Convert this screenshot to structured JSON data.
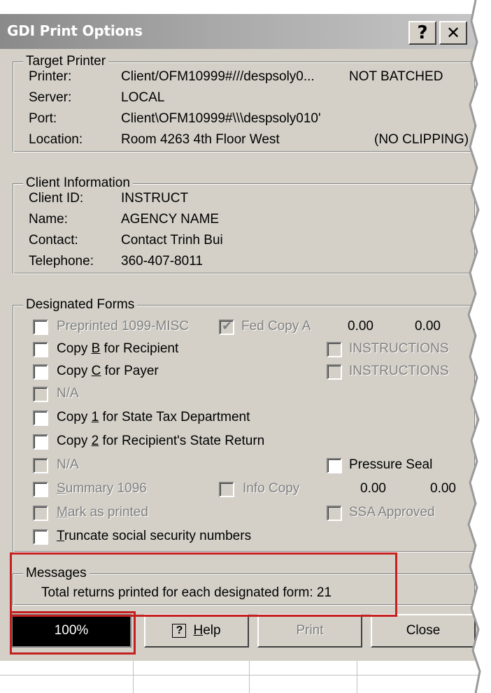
{
  "title": "GDI Print Options",
  "title_buttons": {
    "help": "?",
    "close": "✕"
  },
  "target_printer": {
    "legend": "Target Printer",
    "printer_label": "Printer:",
    "printer_value": "Client/OFM10999#///despsoly0...",
    "batch_status": "NOT BATCHED",
    "server_label": "Server:",
    "server_value": "LOCAL",
    "port_label": "Port:",
    "port_value": "Client\\OFM10999#\\\\\\despsoly010'",
    "location_label": "Location:",
    "location_value": "Room 4263 4th Floor West",
    "clipping_status": "(NO CLIPPING)"
  },
  "client_info": {
    "legend": "Client Information",
    "client_id_label": "Client ID:",
    "client_id_value": "INSTRUCT",
    "name_label": "Name:",
    "name_value": "AGENCY NAME",
    "contact_label": "Contact:",
    "contact_value": "Contact Trinh Bui",
    "telephone_label": "Telephone:",
    "telephone_value": "360-407-8011"
  },
  "forms": {
    "legend": "Designated Forms",
    "preprinted": "Preprinted 1099-MISC",
    "fed_copy_a": "Fed Copy A",
    "fed_val1": "0.00",
    "fed_val2": "0.00",
    "copy_b_pre": "Copy ",
    "copy_b_key": "B",
    "copy_b_post": " for Recipient",
    "instructions1": "INSTRUCTIONS",
    "copy_c_pre": "Copy ",
    "copy_c_key": "C",
    "copy_c_post": " for Payer",
    "instructions2": "INSTRUCTIONS",
    "na1": "N/A",
    "copy_1_pre": "Copy ",
    "copy_1_key": "1",
    "copy_1_post": " for State Tax Department",
    "copy_2_pre": "Copy ",
    "copy_2_key": "2",
    "copy_2_post": " for Recipient's State Return",
    "na2": "N/A",
    "pressure_seal": "Pressure Seal",
    "summary_key": "S",
    "summary_post": "ummary 1096",
    "info_copy": "Info Copy",
    "sum_val1": "0.00",
    "sum_val2": "0.00",
    "mark_key": "M",
    "mark_post": "ark as printed",
    "ssa_approved": "SSA Approved",
    "truncate_key": "T",
    "truncate_post": "runcate social security numbers"
  },
  "messages": {
    "legend": "Messages",
    "text": "Total returns printed for each designated form: 21"
  },
  "buttons": {
    "progress": "100%",
    "help_icon": "?",
    "help_key": "H",
    "help_post": "elp",
    "print": "Print",
    "close": "Close"
  },
  "colors": {
    "highlight": "#c42020",
    "face": "#d4d0c8"
  }
}
